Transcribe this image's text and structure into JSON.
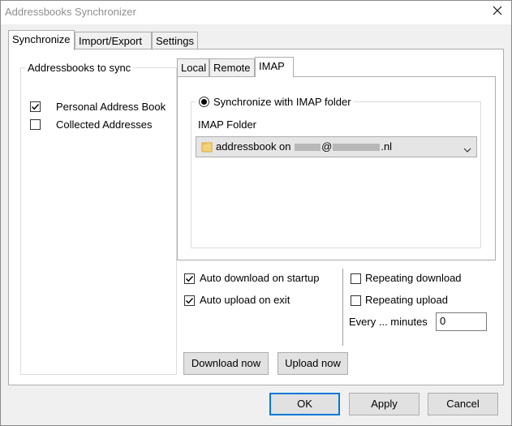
{
  "window": {
    "title": "Addressbooks Synchronizer"
  },
  "main_tabs": [
    {
      "label": "Synchronize",
      "active": true
    },
    {
      "label": "Import/Export",
      "active": false
    },
    {
      "label": "Settings",
      "active": false
    }
  ],
  "addressbooks": {
    "legend": "Addressbooks to sync",
    "items": [
      {
        "label": "Personal Address Book",
        "checked": true
      },
      {
        "label": "Collected Addresses",
        "checked": false
      }
    ]
  },
  "sub_tabs": [
    {
      "label": "Local",
      "active": false
    },
    {
      "label": "Remote",
      "active": false
    },
    {
      "label": "IMAP",
      "active": true
    }
  ],
  "imap": {
    "radio_label": "Synchronize with IMAP folder",
    "radio_selected": true,
    "folder_label": "IMAP Folder",
    "folder_value_prefix": "addressbook on ",
    "folder_value_at": "@",
    "folder_value_suffix": ".nl"
  },
  "options": {
    "auto_download": {
      "label": "Auto download on startup",
      "checked": true
    },
    "auto_upload": {
      "label": "Auto upload on exit",
      "checked": true
    },
    "repeating_download": {
      "label": "Repeating download",
      "checked": false
    },
    "repeating_upload": {
      "label": "Repeating upload",
      "checked": false
    },
    "every_minutes_label": "Every ... minutes",
    "every_minutes_value": "0"
  },
  "actions": {
    "download_now": "Download now",
    "upload_now": "Upload now"
  },
  "footer": {
    "ok": "OK",
    "apply": "Apply",
    "cancel": "Cancel"
  },
  "colors": {
    "default_button_border": "#0078d7",
    "title_text": "#8f8f8f"
  }
}
